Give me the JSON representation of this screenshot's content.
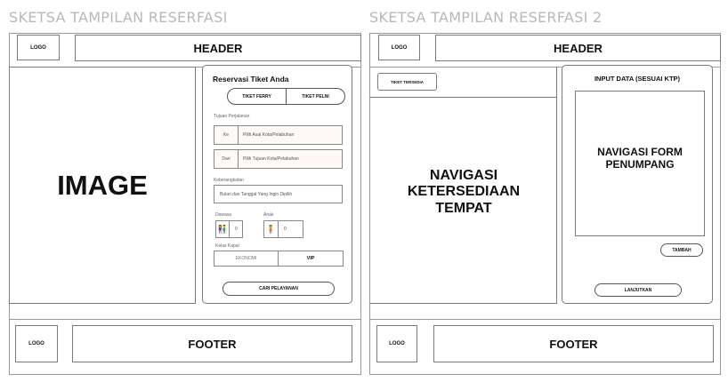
{
  "sketch1": {
    "title": "SKETSA TAMPILAN RESERFASI",
    "logo": "LOGO",
    "header": "HEADER",
    "image": "IMAGE",
    "footer_logo": "LOGO",
    "footer": "FOOTER",
    "form": {
      "title": "Reservasi Tiket Anda",
      "tab_ferry": "TIKET FERRY",
      "tab_pelni": "TIKET PELNI",
      "destination_label": "Tujuan Perjalanan",
      "to_label": "Ke",
      "to_placeholder": "Pilih Asal Kota/Pelabuhan",
      "from_label": "Dari",
      "from_placeholder": "Pilih Tujuan Kota/Pelabuhan",
      "departure_label": "Keberangkatan",
      "departure_placeholder": "Bulan dan Tanggal Yang Ingin Dipilih",
      "adult_label": "Dewasa",
      "adult_value": "0",
      "child_label": "Anak",
      "child_value": "0",
      "class_label": "Kelas Kapal",
      "class_economy": "EKONOMI",
      "class_vip": "VIP",
      "search_button": "CARI PELAYANAN"
    }
  },
  "sketch2": {
    "title": "SKETSA TAMPILAN RESERFASI 2",
    "logo": "LOGO",
    "header": "HEADER",
    "ticket_tab": "TIKET TERSEDIA",
    "nav_availability": "NAVIGASI KETERSEDIAAN TEMPAT",
    "input_title": "INPUT DATA (SESUAI KTP)",
    "nav_passenger_form": "NAVIGASI FORM PENUMPANG",
    "add_button": "TAMBAH",
    "continue_button": "LANJUTKAN",
    "footer_logo": "LOGO",
    "footer": "FOOTER"
  }
}
